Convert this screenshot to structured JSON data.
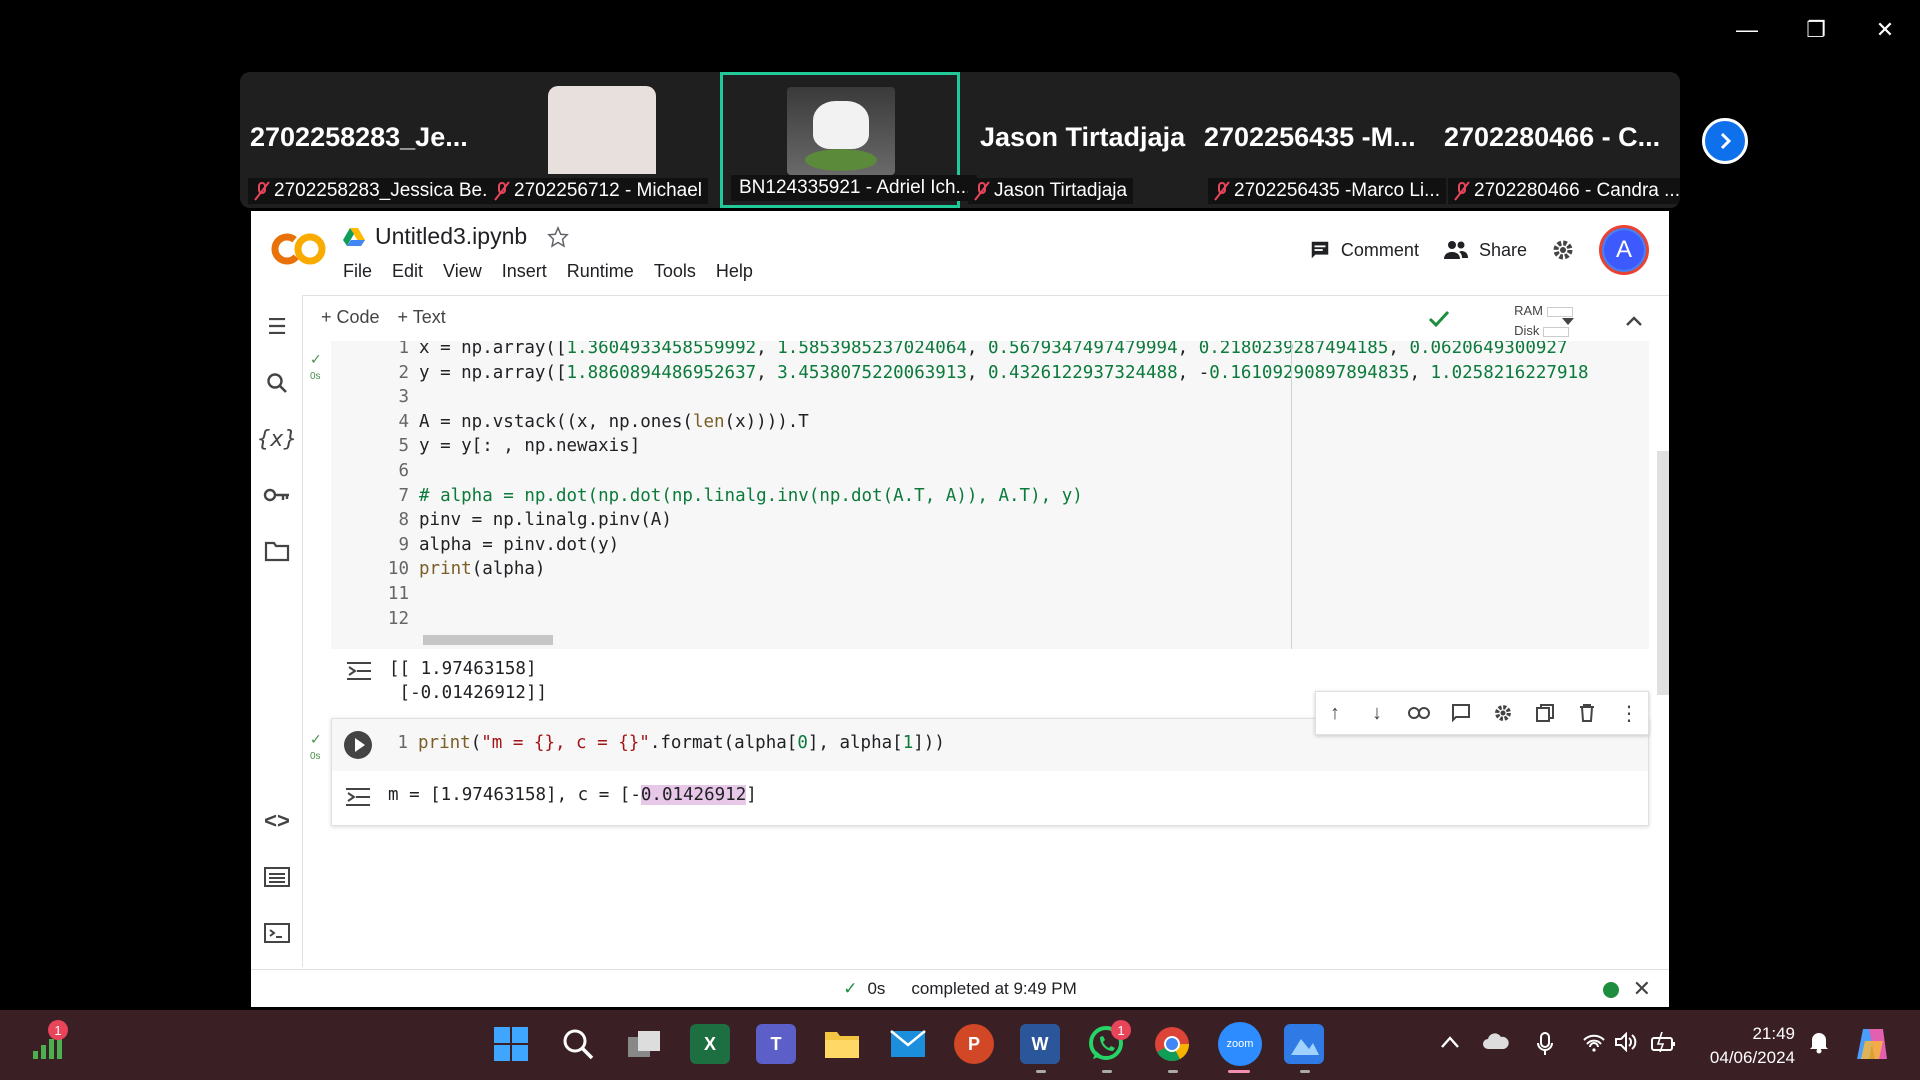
{
  "window": {
    "minimize": "—",
    "restore": "❐",
    "close": "✕"
  },
  "zoom": {
    "participants": [
      {
        "big_name": "2702258283_Je...",
        "label": "2702258283_Jessica Be..."
      },
      {
        "big_name": "",
        "label": "2702256712 - Michael"
      },
      {
        "big_name": "",
        "label": "BN124335921 - Adriel Ich..."
      },
      {
        "big_name": "Jason Tirtadjaja",
        "label": "Jason Tirtadjaja"
      },
      {
        "big_name": "2702256435  -M...",
        "label": "2702256435 -Marco Li..."
      },
      {
        "big_name": "2702280466  - C...",
        "label": "2702280466 - Candra ..."
      }
    ]
  },
  "colab": {
    "logo": "CO",
    "title": "Untitled3.ipynb",
    "menu": [
      "File",
      "Edit",
      "View",
      "Insert",
      "Runtime",
      "Tools",
      "Help"
    ],
    "comment": "Comment",
    "share": "Share",
    "avatar_letter": "A",
    "add_code": "+ Code",
    "add_text": "+ Text",
    "ram": "RAM",
    "disk": "Disk",
    "cell1": {
      "exec_time": "0s",
      "output": "[[ 1.97463158]\n [-0.01426912]]"
    },
    "cell2": {
      "exec_time": "0s",
      "line_no": "1",
      "output_prefix": "m = [1.97463158], c = [-",
      "output_highlight": "0.01426912",
      "output_suffix": "]"
    },
    "status": {
      "time": "0s",
      "text": "completed at 9:49 PM"
    }
  },
  "taskbar": {
    "clock_time": "21:49",
    "clock_date": "04/06/2024",
    "signal_badge": "1",
    "whatsapp_badge": "1",
    "zoom_label": "zoom"
  },
  "colors": {
    "colab_orange": "#f9ab00",
    "taskbar_bg": "#3a1f25",
    "zoom_blue": "#0e71eb",
    "active_border": "#20c997"
  }
}
